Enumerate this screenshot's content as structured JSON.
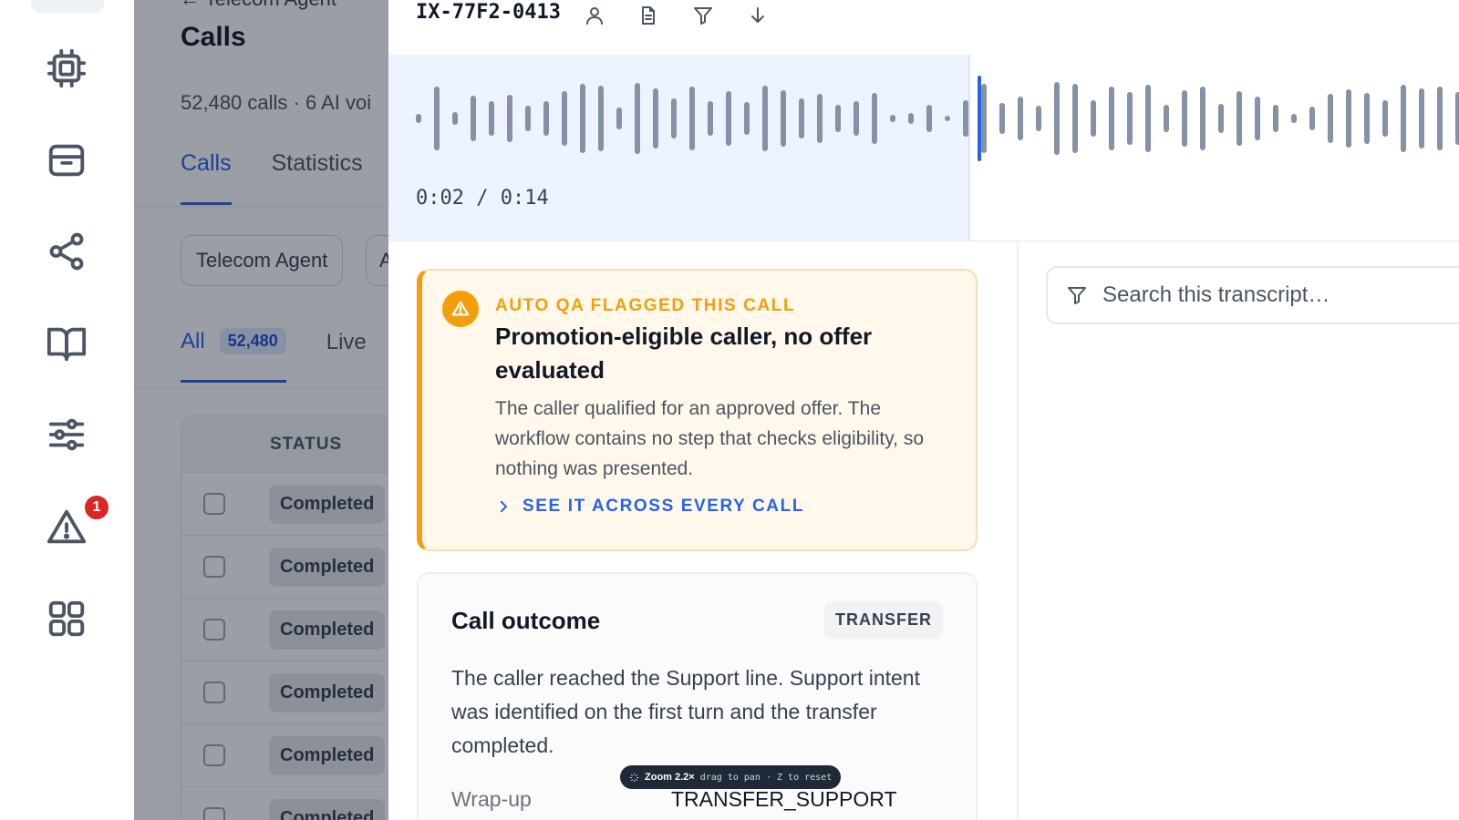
{
  "rail": {
    "notification_count": "1",
    "icons": [
      "cpu-icon",
      "archive-icon",
      "share-icon",
      "book-icon",
      "sliders-icon",
      "alert-icon",
      "grid-icon"
    ]
  },
  "list_page": {
    "breadcrumb": "Telecom Agent",
    "title": "Calls",
    "subtitle": "52,480 calls · 6 AI voi",
    "tabs": [
      "Calls",
      "Statistics"
    ],
    "filter_chip": "Telecom Agent",
    "filter_chip_2": "A",
    "subtabs": {
      "all_label": "All",
      "all_count": "52,480",
      "live_label": "Live"
    },
    "table": {
      "status_header": "STATUS",
      "rows": [
        "Completed",
        "Completed",
        "Completed",
        "Completed",
        "Completed",
        "Completed"
      ]
    }
  },
  "detail": {
    "call_id": "IX-77F2-0413",
    "playback": {
      "time": "0:02 / 0:14",
      "progress_fraction": 0.55
    },
    "qa_flag": {
      "eyebrow": "AUTO QA FLAGGED THIS CALL",
      "title": "Promotion-eligible caller, no offer evaluated",
      "body": "The caller qualified for an approved offer. The workflow contains no step that checks eligibility, so nothing was presented.",
      "link": "SEE IT ACROSS EVERY CALL",
      "accent": "#f59e0b"
    },
    "outcome": {
      "title": "Call outcome",
      "badge": "TRANSFER",
      "body": "The caller reached the Support line. Support intent was identified on the first turn and the transfer completed.",
      "wrapup_label": "Wrap-up",
      "wrapup_value": "TRANSFER_SUPPORT"
    },
    "transcript_search": {
      "placeholder": "Search this transcript…"
    }
  },
  "zoom_hint": {
    "level": "Zoom 2.2×",
    "hint": "drag to pan · Z to reset"
  },
  "colors": {
    "primary": "#2563eb",
    "warning": "#f59e0b",
    "danger": "#dc2626"
  }
}
